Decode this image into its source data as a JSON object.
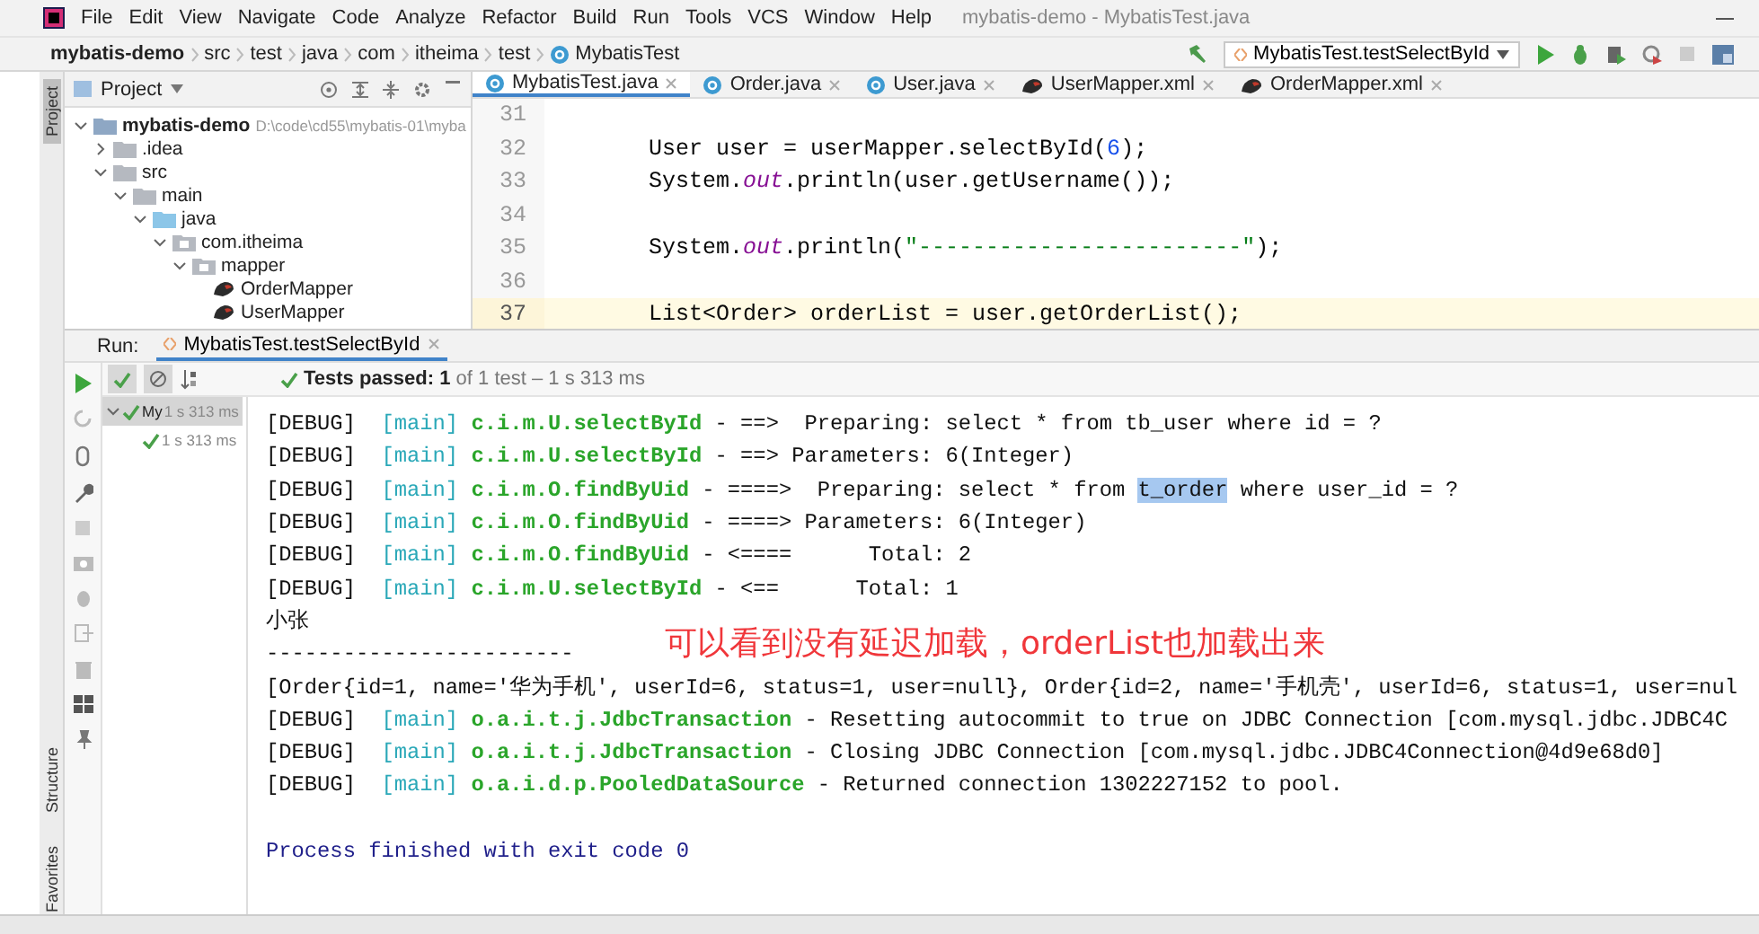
{
  "window": {
    "title": "mybatis-demo - MybatisTest.java"
  },
  "menu": [
    "File",
    "Edit",
    "View",
    "Navigate",
    "Code",
    "Analyze",
    "Refactor",
    "Build",
    "Run",
    "Tools",
    "VCS",
    "Window",
    "Help"
  ],
  "breadcrumb": [
    "mybatis-demo",
    "src",
    "test",
    "java",
    "com",
    "itheima",
    "test",
    "MybatisTest"
  ],
  "run_config": {
    "label": "MybatisTest.testSelectById"
  },
  "side_stripe": [
    {
      "label": "Project",
      "selected": true
    },
    {
      "label": "Structure",
      "selected": false
    },
    {
      "label": "Favorites",
      "selected": false
    }
  ],
  "project": {
    "title": "Project",
    "tree": [
      {
        "label": "mybatis-demo",
        "path": "D:\\code\\cd55\\mybatis-01\\myba",
        "kind": "module",
        "expanded": true,
        "children": [
          {
            "label": ".idea",
            "kind": "folder",
            "expanded": false
          },
          {
            "label": "src",
            "kind": "folder",
            "expanded": true,
            "children": [
              {
                "label": "main",
                "kind": "folder",
                "expanded": true,
                "children": [
                  {
                    "label": "java",
                    "kind": "source",
                    "expanded": true,
                    "children": [
                      {
                        "label": "com.itheima",
                        "kind": "package",
                        "expanded": true,
                        "children": [
                          {
                            "label": "mapper",
                            "kind": "package",
                            "expanded": true,
                            "children": [
                              {
                                "label": "OrderMapper",
                                "kind": "mapper"
                              },
                              {
                                "label": "UserMapper",
                                "kind": "mapper"
                              }
                            ]
                          }
                        ]
                      }
                    ]
                  }
                ]
              }
            ]
          }
        ]
      }
    ]
  },
  "editor": {
    "tabs": [
      {
        "label": "MybatisTest.java",
        "kind": "class",
        "selected": true
      },
      {
        "label": "Order.java",
        "kind": "class",
        "selected": false
      },
      {
        "label": "User.java",
        "kind": "class",
        "selected": false
      },
      {
        "label": "UserMapper.xml",
        "kind": "mapper",
        "selected": false
      },
      {
        "label": "OrderMapper.xml",
        "kind": "mapper",
        "selected": false
      }
    ],
    "lines": [
      {
        "number": "31",
        "current": false
      },
      {
        "number": "32",
        "current": false,
        "tokens": [
          {
            "text": "User user = userMapper.selectById(",
            "kind": "plain"
          },
          {
            "text": "6",
            "kind": "number"
          },
          {
            "text": ");",
            "kind": "plain"
          }
        ]
      },
      {
        "number": "33",
        "current": false,
        "tokens": [
          {
            "text": "System.",
            "kind": "plain"
          },
          {
            "text": "out",
            "kind": "field"
          },
          {
            "text": ".println(user.getUsername());",
            "kind": "plain"
          }
        ]
      },
      {
        "number": "34",
        "current": false
      },
      {
        "number": "35",
        "current": false,
        "tokens": [
          {
            "text": "System.",
            "kind": "plain"
          },
          {
            "text": "out",
            "kind": "field"
          },
          {
            "text": ".println(",
            "kind": "plain"
          },
          {
            "text": "\"------------------------\"",
            "kind": "string"
          },
          {
            "text": ");",
            "kind": "plain"
          }
        ]
      },
      {
        "number": "36",
        "current": false
      },
      {
        "number": "37",
        "current": true,
        "tokens": [
          {
            "text": "List<Order> orderList = user.getOrderList();",
            "kind": "plain"
          }
        ]
      }
    ]
  },
  "run": {
    "label": "Run:",
    "tab": "MybatisTest.testSelectById",
    "status": "**Tests passed: 1** of 1 test – 1 s 313 ms",
    "tests": [
      {
        "name": "My",
        "time": "1 s 313 ms",
        "selected": true,
        "expanded": true,
        "passed": true
      },
      {
        "time": "1 s 313 ms",
        "selected": false,
        "passed": true
      }
    ],
    "console": [
      {
        "kind": "log",
        "level": "[DEBUG]",
        "thread": "[main]",
        "logger": "c.i.m.U.selectById",
        "message": [
          {
            "text": " - ==>  Preparing: select * from tb_user where id = ?",
            "selected": false
          }
        ]
      },
      {
        "kind": "log",
        "level": "[DEBUG]",
        "thread": "[main]",
        "logger": "c.i.m.U.selectById",
        "message": [
          {
            "text": " - ==> Parameters: 6(Integer)",
            "selected": false
          }
        ]
      },
      {
        "kind": "log",
        "level": "[DEBUG]",
        "thread": "[main]",
        "logger": "c.i.m.O.findByUid",
        "message": [
          {
            "text": " - ====>  Preparing: select * from ",
            "selected": false
          },
          {
            "text": "t_order",
            "selected": true
          },
          {
            "text": " where user_id = ?",
            "selected": false
          }
        ]
      },
      {
        "kind": "log",
        "level": "[DEBUG]",
        "thread": "[main]",
        "logger": "c.i.m.O.findByUid",
        "message": [
          {
            "text": " - ====> Parameters: 6(Integer)",
            "selected": false
          }
        ]
      },
      {
        "kind": "log",
        "level": "[DEBUG]",
        "thread": "[main]",
        "logger": "c.i.m.O.findByUid",
        "message": [
          {
            "text": " - <====      Total: 2",
            "selected": false
          }
        ]
      },
      {
        "kind": "log",
        "level": "[DEBUG]",
        "thread": "[main]",
        "logger": "c.i.m.U.selectById",
        "message": [
          {
            "text": " - <==      Total: 1",
            "selected": false
          }
        ]
      },
      {
        "kind": "plain",
        "text": "小张"
      },
      {
        "kind": "plain",
        "text": "------------------------"
      },
      {
        "kind": "plain",
        "text": "[Order{id=1, name='华为手机', userId=6, status=1, user=null}, Order{id=2, name='手机壳', userId=6, status=1, user=nul"
      },
      {
        "kind": "log",
        "level": "[DEBUG]",
        "thread": "[main]",
        "logger": "o.a.i.t.j.JdbcTransaction",
        "message": [
          {
            "text": " - Resetting autocommit to true on JDBC Connection [com.mysql.jdbc.JDBC4C",
            "selected": false
          }
        ]
      },
      {
        "kind": "log",
        "level": "[DEBUG]",
        "thread": "[main]",
        "logger": "o.a.i.t.j.JdbcTransaction",
        "message": [
          {
            "text": " - Closing JDBC Connection [com.mysql.jdbc.JDBC4Connection@4d9e68d0]",
            "selected": false
          }
        ]
      },
      {
        "kind": "log",
        "level": "[DEBUG]",
        "thread": "[main]",
        "logger": "o.a.i.d.p.PooledDataSource",
        "message": [
          {
            "text": " - Returned connection 1302227152 to pool.",
            "selected": false
          }
        ]
      },
      {
        "kind": "blank"
      },
      {
        "kind": "exit",
        "text": "Process finished with exit code 0"
      }
    ]
  },
  "annotation": {
    "text": "可以看到没有延迟加载，orderList也加载出来"
  }
}
